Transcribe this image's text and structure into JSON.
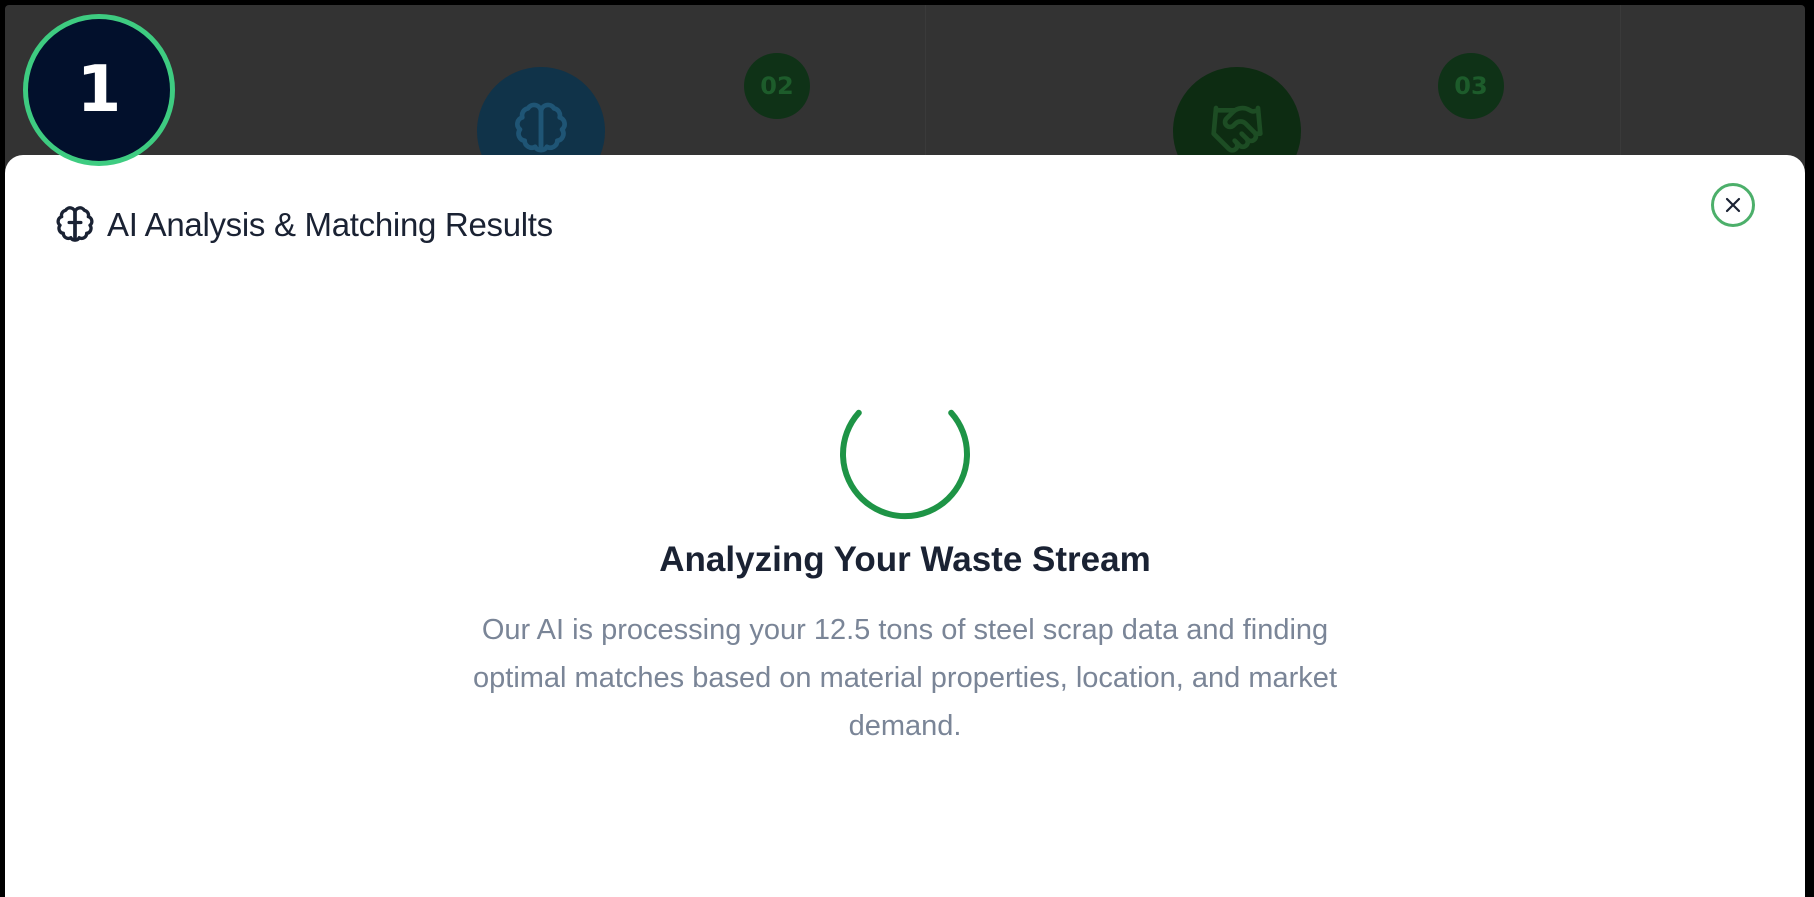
{
  "step_badge": {
    "number": "1"
  },
  "background_steps": [
    {
      "badge": "02",
      "icon": "brain-icon"
    },
    {
      "badge": "03",
      "icon": "handshake-icon"
    }
  ],
  "modal": {
    "title": "AI Analysis & Matching Results",
    "title_icon": "brain-icon",
    "close_icon": "close-icon"
  },
  "loading": {
    "heading": "Analyzing Your Waste Stream",
    "description": "Our AI is processing your 12.5 tons of steel scrap data and finding optimal matches based on material properties, location, and market demand."
  },
  "colors": {
    "accent_green": "#1e9446",
    "badge_border": "#3ecc81",
    "badge_fill": "#02102c",
    "text_dark": "#1a2233",
    "text_muted": "#7a8597",
    "backdrop": "#333333"
  }
}
